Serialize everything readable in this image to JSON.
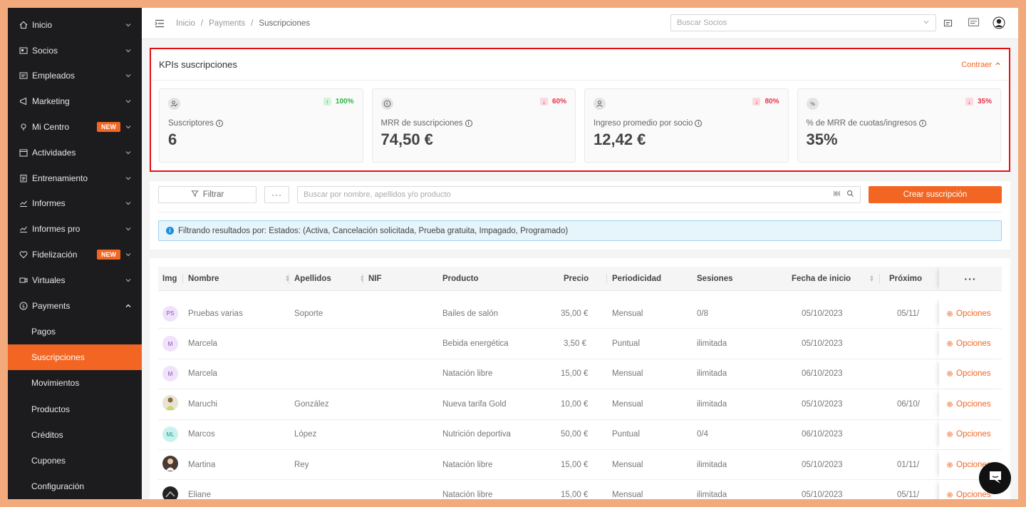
{
  "sidebar": {
    "items": [
      {
        "label": "Inicio",
        "icon": "home-icon"
      },
      {
        "label": "Socios",
        "icon": "id-card-icon"
      },
      {
        "label": "Empleados",
        "icon": "badge-icon"
      },
      {
        "label": "Marketing",
        "icon": "megaphone-icon"
      },
      {
        "label": "Mi Centro",
        "icon": "location-icon",
        "badge": "NEW"
      },
      {
        "label": "Actividades",
        "icon": "calendar-icon"
      },
      {
        "label": "Entrenamiento",
        "icon": "clipboard-icon"
      },
      {
        "label": "Informes",
        "icon": "chart-icon"
      },
      {
        "label": "Informes pro",
        "icon": "chart-icon"
      },
      {
        "label": "Fidelización",
        "icon": "heart-icon",
        "badge": "NEW"
      },
      {
        "label": "Virtuales",
        "icon": "video-icon"
      },
      {
        "label": "Payments",
        "icon": "dollar-icon"
      }
    ],
    "sub": [
      "Pagos",
      "Suscripciones",
      "Movimientos",
      "Productos",
      "Créditos",
      "Cupones",
      "Configuración"
    ]
  },
  "topbar": {
    "crumbs": [
      "Inicio",
      "/",
      "Payments",
      "/",
      "Suscripciones"
    ],
    "search_placeholder": "Buscar Socios"
  },
  "kpis": {
    "title": "KPIs suscripciones",
    "collapse_label": "Contraer",
    "cards": [
      {
        "label": "Suscriptores",
        "value": "6",
        "trend": "100%",
        "direction": "up",
        "icon": "users-icon"
      },
      {
        "label": "MRR de suscripciones",
        "value": "74,50 €",
        "trend": "60%",
        "direction": "down",
        "icon": "euro-icon"
      },
      {
        "label": "Ingreso promedio por socio",
        "value": "12,42 €",
        "trend": "80%",
        "direction": "down",
        "icon": "user-icon"
      },
      {
        "label": "% de MRR de cuotas/ingresos",
        "value": "35%",
        "trend": "35%",
        "direction": "down",
        "icon": "percent-icon"
      }
    ]
  },
  "filters": {
    "filter_label": "Filtrar",
    "more_label": "···",
    "search_placeholder": "Buscar por nombre, apellidos y/o producto",
    "create_label": "Crear suscripción",
    "alert": "Filtrando resultados por: Estados: (Activa, Cancelación solicitada, Prueba gratuita, Impagado, Programado)"
  },
  "table": {
    "headers": {
      "img": "Img",
      "nombre": "Nombre",
      "apellidos": "Apellidos",
      "nif": "NIF",
      "producto": "Producto",
      "precio": "Precio",
      "periodicidad": "Periodicidad",
      "sesiones": "Sesiones",
      "fecha": "Fecha de inicio",
      "proximo": "Próximo",
      "actions": "···"
    },
    "options_label": "Opciones",
    "rows": [
      {
        "avatar": "PS",
        "nombre": "Pruebas varias",
        "apellidos": "Soporte",
        "producto": "Bailes de salón",
        "precio": "35,00 €",
        "periodicidad": "Mensual",
        "sesiones": "0/8",
        "fecha": "05/10/2023",
        "proximo": "05/11/"
      },
      {
        "avatar": "M",
        "nombre": "Marcela",
        "apellidos": "",
        "producto": "Bebida energética",
        "precio": "3,50 €",
        "periodicidad": "Puntual",
        "sesiones": "ilimitada",
        "fecha": "05/10/2023",
        "proximo": ""
      },
      {
        "avatar": "M",
        "nombre": "Marcela",
        "apellidos": "",
        "producto": "Natación libre",
        "precio": "15,00 €",
        "periodicidad": "Mensual",
        "sesiones": "ilimitada",
        "fecha": "06/10/2023",
        "proximo": ""
      },
      {
        "avatar": "",
        "nombre": "Maruchi",
        "apellidos": "González",
        "producto": "Nueva tarifa Gold",
        "precio": "10,00 €",
        "periodicidad": "Mensual",
        "sesiones": "ilimitada",
        "fecha": "05/10/2023",
        "proximo": "06/10/"
      },
      {
        "avatar": "ML",
        "nombre": "Marcos",
        "apellidos": "López",
        "producto": "Nutrición deportiva",
        "precio": "50,00 €",
        "periodicidad": "Puntual",
        "sesiones": "0/4",
        "fecha": "06/10/2023",
        "proximo": ""
      },
      {
        "avatar": "",
        "nombre": "Martina",
        "apellidos": "Rey",
        "producto": "Natación libre",
        "precio": "15,00 €",
        "periodicidad": "Mensual",
        "sesiones": "ilimitada",
        "fecha": "05/10/2023",
        "proximo": "01/11/"
      },
      {
        "avatar": "",
        "nombre": "Eliane",
        "apellidos": "",
        "producto": "Natación libre",
        "precio": "15,00 €",
        "periodicidad": "Mensual",
        "sesiones": "ilimitada",
        "fecha": "05/10/2023",
        "proximo": "05/11/"
      }
    ]
  },
  "colors": {
    "accent": "#f26522",
    "sidebar_bg": "#1c1c1e",
    "highlight_border": "#e60f0f"
  }
}
